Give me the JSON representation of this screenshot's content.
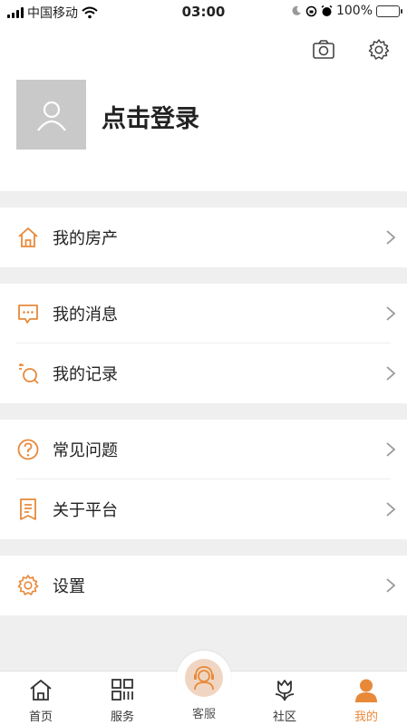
{
  "status_bar": {
    "carrier": "中国移动",
    "time": "03:00",
    "battery": "100%"
  },
  "header": {
    "login_text": "点击登录",
    "icons": [
      "camera-icon",
      "settings-gear-icon"
    ]
  },
  "menu": {
    "group1": [
      {
        "label": "我的房产",
        "icon": "house-icon"
      }
    ],
    "group2": [
      {
        "label": "我的消息",
        "icon": "message-icon"
      },
      {
        "label": "我的记录",
        "icon": "record-icon"
      }
    ],
    "group3": [
      {
        "label": "常见问题",
        "icon": "question-icon"
      },
      {
        "label": "关于平台",
        "icon": "document-icon"
      }
    ],
    "group4": [
      {
        "label": "设置",
        "icon": "gear-icon"
      }
    ]
  },
  "tabbar": {
    "home": "首页",
    "service": "服务",
    "customer_service": "客服",
    "community": "社区",
    "mine": "我的",
    "active": "mine"
  },
  "colors": {
    "accent": "#e8893a",
    "background": "#efefef",
    "avatar_bg": "#c9c9c9"
  }
}
